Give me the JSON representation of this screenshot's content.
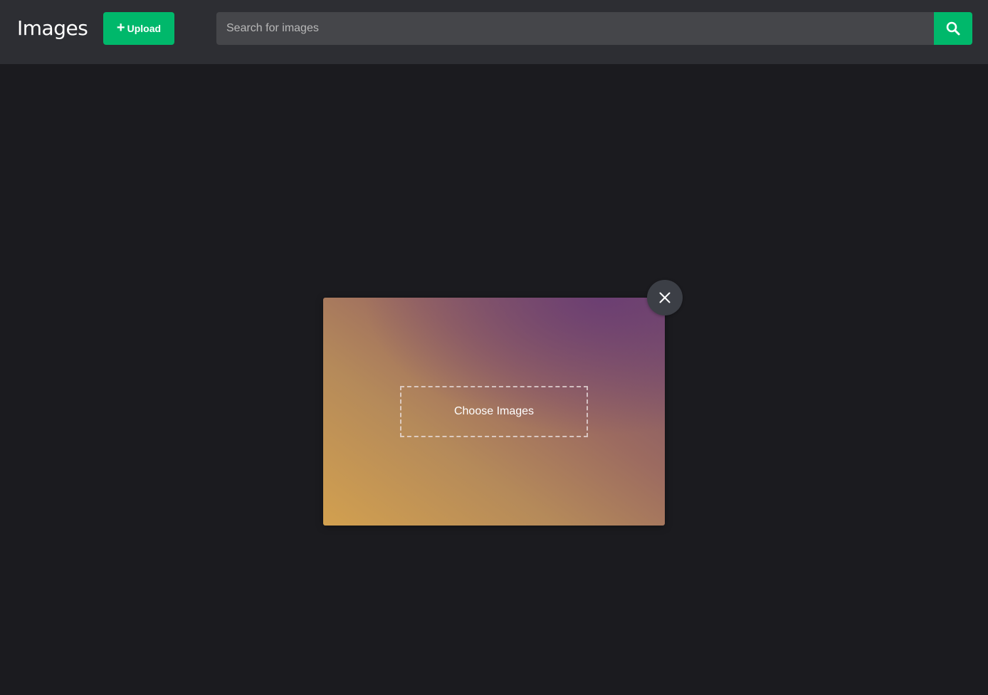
{
  "header": {
    "title": "Images",
    "upload_label": "Upload",
    "upload_icon": "+"
  },
  "search": {
    "placeholder": "Search for images",
    "value": "",
    "icon": "search-icon"
  },
  "modal": {
    "dropzone_label": "Choose Images",
    "close_icon": "close-icon"
  },
  "colors": {
    "accent": "#00b86b",
    "topbar_bg": "#2d2e33",
    "page_bg": "#1b1b1f",
    "search_bg": "#45464a",
    "close_button_bg": "#3c3f46"
  }
}
